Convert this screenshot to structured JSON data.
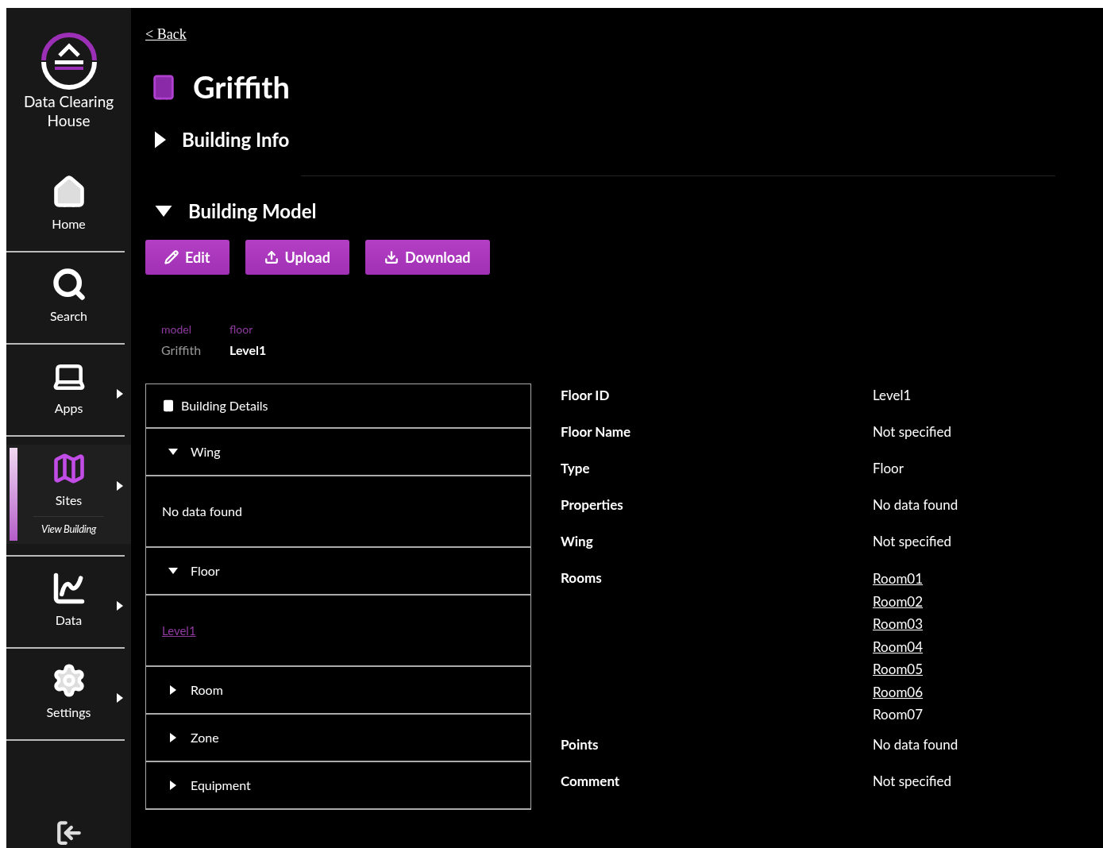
{
  "brand": {
    "name": "Data Clearing House"
  },
  "nav": [
    {
      "label": "Home",
      "kind": "home",
      "selected": false,
      "has_submenu": false
    },
    {
      "label": "Search",
      "kind": "search",
      "selected": false,
      "has_submenu": false
    },
    {
      "label": "Apps",
      "kind": "apps",
      "selected": false,
      "has_submenu": true
    },
    {
      "label": "Sites",
      "kind": "sites",
      "selected": true,
      "has_submenu": true,
      "sub_label": "View Building"
    },
    {
      "label": "Data",
      "kind": "data",
      "selected": false,
      "has_submenu": true
    },
    {
      "label": "Settings",
      "kind": "settings",
      "selected": false,
      "has_submenu": true
    }
  ],
  "back_link": "< Back",
  "title": "Griffith",
  "sections": [
    {
      "label": "Building Info",
      "expanded": false
    },
    {
      "label": "Building Model",
      "expanded": true
    }
  ],
  "buttons": [
    {
      "label": "Edit",
      "kind": "edit"
    },
    {
      "label": "Upload",
      "kind": "upload"
    },
    {
      "label": "Download",
      "kind": "download"
    }
  ],
  "breadcrumb": [
    {
      "type": "model",
      "value": "Griffith",
      "current": false
    },
    {
      "type": "floor",
      "value": "Level1",
      "current": true
    }
  ],
  "tree": {
    "header": "Building Details",
    "groups": [
      {
        "label": "Wing",
        "expanded": true,
        "content": "No data found",
        "link": false
      },
      {
        "label": "Floor",
        "expanded": true,
        "content": "Level1",
        "link": true
      },
      {
        "label": "Room",
        "expanded": false
      },
      {
        "label": "Zone",
        "expanded": false
      },
      {
        "label": "Equipment",
        "expanded": false
      }
    ]
  },
  "details": [
    {
      "label": "Floor ID",
      "values": [
        {
          "text": "Level1",
          "link": false
        }
      ]
    },
    {
      "label": "Floor Name",
      "values": [
        {
          "text": "Not specified",
          "link": false
        }
      ]
    },
    {
      "label": "Type",
      "values": [
        {
          "text": "Floor",
          "link": false
        }
      ]
    },
    {
      "label": "Properties",
      "values": [
        {
          "text": "No data found",
          "link": false
        }
      ]
    },
    {
      "label": "Wing",
      "values": [
        {
          "text": "Not specified",
          "link": false
        }
      ]
    },
    {
      "label": "Rooms",
      "values": [
        {
          "text": "Room01",
          "link": true
        },
        {
          "text": "Room02",
          "link": true
        },
        {
          "text": "Room03",
          "link": true
        },
        {
          "text": "Room04",
          "link": true
        },
        {
          "text": "Room05",
          "link": true
        },
        {
          "text": "Room06",
          "link": true
        },
        {
          "text": "Room07",
          "link": false
        }
      ]
    },
    {
      "label": "Points",
      "values": [
        {
          "text": "No data found",
          "link": false
        }
      ]
    },
    {
      "label": "Comment",
      "values": [
        {
          "text": "Not specified",
          "link": false
        }
      ]
    }
  ]
}
